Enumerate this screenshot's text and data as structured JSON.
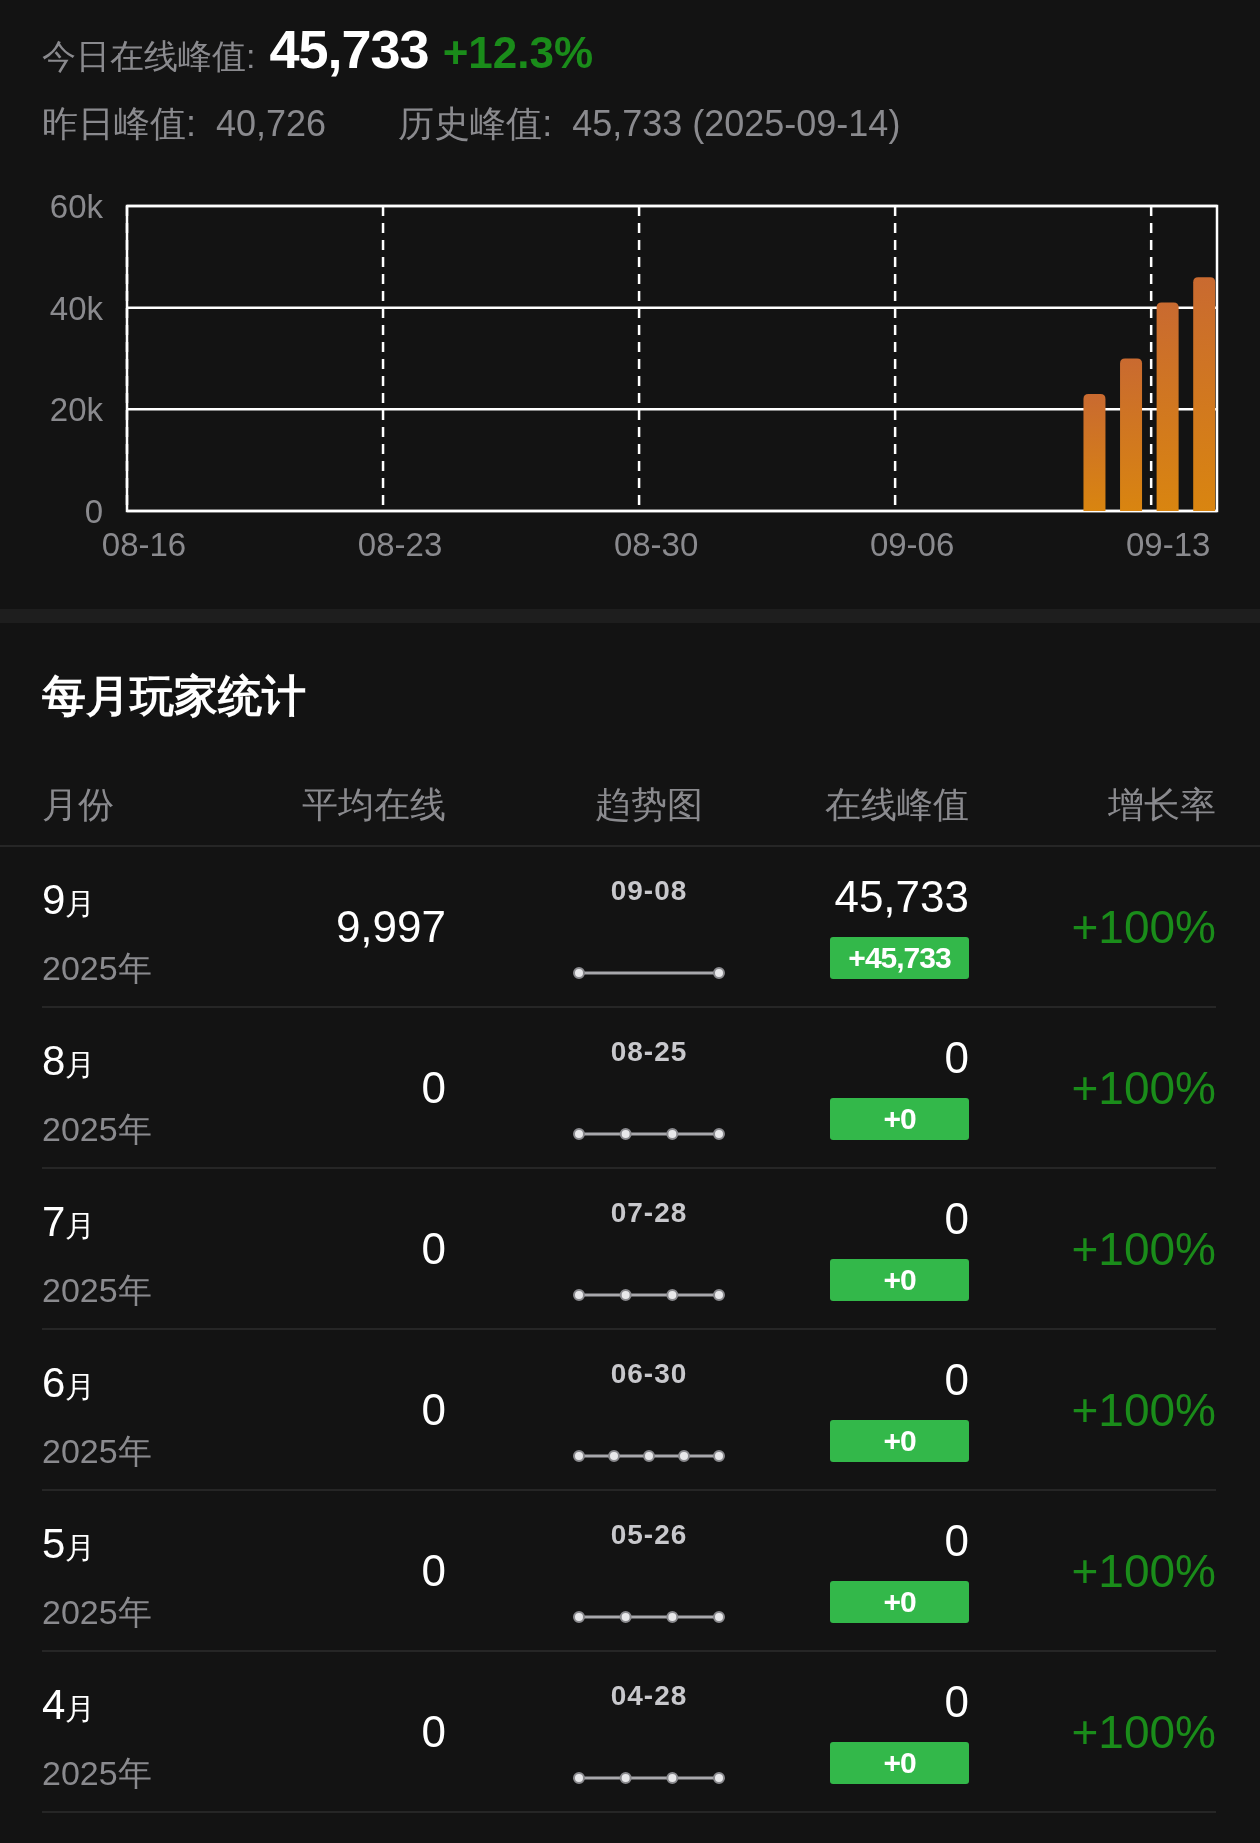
{
  "summary": {
    "today_label": "今日在线峰值:",
    "today_value": "45,733",
    "today_change": "+12.3%",
    "yesterday_label": "昨日峰值:",
    "yesterday_value": "40,726",
    "record_label": "历史峰值:",
    "record_value": "45,733 (2025-09-14)"
  },
  "chart": {
    "chart_data": {
      "type": "bar",
      "categories": [
        "08-16",
        null,
        null,
        null,
        null,
        null,
        null,
        "08-23",
        null,
        null,
        null,
        null,
        null,
        null,
        "08-30",
        null,
        null,
        null,
        null,
        null,
        null,
        "09-06",
        null,
        null,
        null,
        null,
        null,
        null,
        "09-13",
        null
      ],
      "values": [
        null,
        null,
        null,
        null,
        null,
        null,
        null,
        null,
        null,
        null,
        null,
        null,
        null,
        null,
        null,
        null,
        null,
        null,
        null,
        null,
        null,
        null,
        null,
        null,
        null,
        null,
        23000,
        30000,
        41000,
        46000
      ],
      "ylim": [
        0,
        60000
      ],
      "yticks": [
        {
          "value": 0,
          "label": "0"
        },
        {
          "value": 20000,
          "label": "20k"
        },
        {
          "value": 40000,
          "label": "40k"
        },
        {
          "value": 60000,
          "label": "60k"
        }
      ]
    }
  },
  "monthly": {
    "title": "每月玩家统计",
    "columns": [
      "月份",
      "平均在线",
      "趋势图",
      "在线峰值",
      "增长率"
    ],
    "rows": [
      {
        "month": "9",
        "month_unit": "月",
        "year": "2025年",
        "average": "9,997",
        "trend_date": "09-08",
        "kind": "two_point",
        "peak": "45,733",
        "peak_change": "+45,733",
        "growth": "+100%"
      },
      {
        "month": "8",
        "month_unit": "月",
        "year": "2025年",
        "average": "0",
        "trend_date": "08-25",
        "kind": "four_point",
        "peak": "0",
        "peak_change": "+0",
        "growth": "+100%"
      },
      {
        "month": "7",
        "month_unit": "月",
        "year": "2025年",
        "average": "0",
        "trend_date": "07-28",
        "kind": "four_point",
        "peak": "0",
        "peak_change": "+0",
        "growth": "+100%"
      },
      {
        "month": "6",
        "month_unit": "月",
        "year": "2025年",
        "average": "0",
        "trend_date": "06-30",
        "kind": "five_point",
        "peak": "0",
        "peak_change": "+0",
        "growth": "+100%"
      },
      {
        "month": "5",
        "month_unit": "月",
        "year": "2025年",
        "average": "0",
        "trend_date": "05-26",
        "kind": "four_point",
        "peak": "0",
        "peak_change": "+0",
        "growth": "+100%"
      },
      {
        "month": "4",
        "month_unit": "月",
        "year": "2025年",
        "average": "0",
        "trend_date": "04-28",
        "kind": "four_point",
        "peak": "0",
        "peak_change": "+0",
        "growth": "+100%"
      }
    ]
  }
}
